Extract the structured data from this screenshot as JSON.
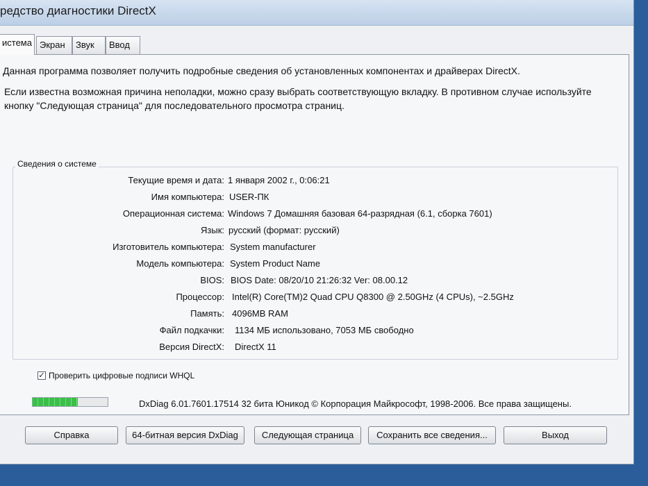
{
  "window": {
    "title": "редство диагностики DirectX"
  },
  "tabs": [
    {
      "label": "истема"
    },
    {
      "label": "Экран"
    },
    {
      "label": "Звук"
    },
    {
      "label": "Ввод"
    }
  ],
  "intro": {
    "line1": "Данная программа позволяет получить подробные сведения об установленных компонентах и драйверах DirectX.",
    "line2": "Если известна возможная причина неполадки, можно сразу выбрать соответствующую вкладку. В противном случае используйте кнопку \"Следующая страница\" для последовательного просмотра страниц."
  },
  "system_info": {
    "title": "Сведения о системе",
    "rows": [
      {
        "label": "Текущие время и дата:",
        "value": "1 января 2002 г., 0:06:21"
      },
      {
        "label": "Имя компьютера:",
        "value": "USER-ПК"
      },
      {
        "label": "Операционная система:",
        "value": "Windows 7 Домашняя базовая 64-разрядная (6.1, сборка 7601)"
      },
      {
        "label": "Язык:",
        "value": "русский (формат: русский)"
      },
      {
        "label": "Изготовитель компьютера:",
        "value": "System manufacturer"
      },
      {
        "label": "Модель компьютера:",
        "value": "System Product Name"
      },
      {
        "label": "BIOS:",
        "value": "BIOS Date: 08/20/10 21:26:32 Ver: 08.00.12"
      },
      {
        "label": "Процессор:",
        "value": "Intel(R) Core(TM)2 Quad CPU    Q8300  @ 2.50GHz (4 CPUs), ~2.5GHz"
      },
      {
        "label": "Память:",
        "value": "4096MB RAM"
      },
      {
        "label": "Файл подкачки:",
        "value": "1134 МБ использовано, 7053 МБ свободно"
      },
      {
        "label": "Версия DirectX:",
        "value": "DirectX 11"
      }
    ]
  },
  "whql": {
    "label": "Проверить цифровые подписи WHQL",
    "checked": true,
    "check_glyph": "✓"
  },
  "progress": {
    "percent": 60
  },
  "footer": {
    "text": "DxDiag 6.01.7601.17514 32 бита Юникод  © Корпорация Майкрософт, 1998-2006.  Все права защищены."
  },
  "buttons": {
    "help": "Справка",
    "dxdiag64": "64-битная версия DxDiag",
    "next": "Следующая страница",
    "save_all": "Сохранить все сведения...",
    "exit": "Выход"
  }
}
